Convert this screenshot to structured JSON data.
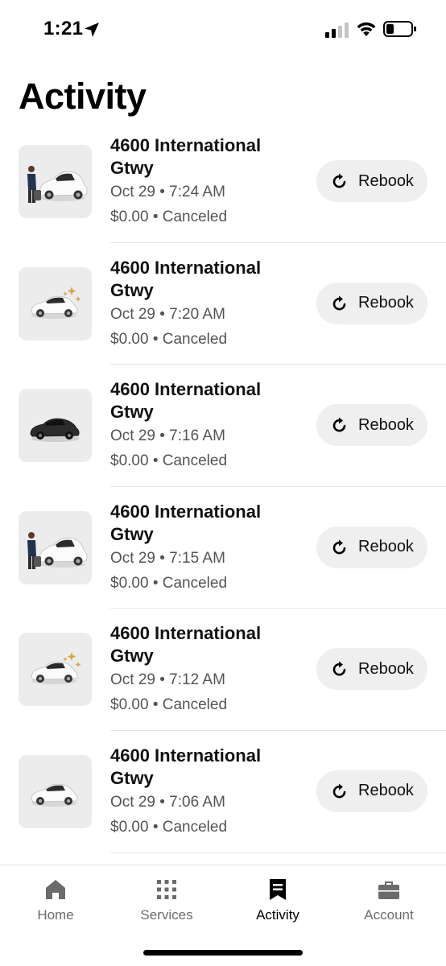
{
  "status_bar": {
    "time": "1:21",
    "icons": [
      "location-arrow-icon",
      "cellular-signal-icon",
      "wifi-icon",
      "battery-icon"
    ]
  },
  "page": {
    "title": "Activity"
  },
  "trips": [
    {
      "address": "4600 International Gtwy",
      "date": "Oct 29 • 7:24 AM",
      "price_status": "$0.00 • Canceled",
      "rebook_label": "Rebook",
      "thumbnail": "car-with-passenger-icon"
    },
    {
      "address": "4600 International Gtwy",
      "date": "Oct 29 • 7:20 AM",
      "price_status": "$0.00 • Canceled",
      "rebook_label": "Rebook",
      "thumbnail": "car-with-sparkles-icon"
    },
    {
      "address": "4600 International Gtwy",
      "date": "Oct 29 • 7:16 AM",
      "price_status": "$0.00 • Canceled",
      "rebook_label": "Rebook",
      "thumbnail": "black-car-icon"
    },
    {
      "address": "4600 International Gtwy",
      "date": "Oct 29 • 7:15 AM",
      "price_status": "$0.00 • Canceled",
      "rebook_label": "Rebook",
      "thumbnail": "car-with-passenger-icon"
    },
    {
      "address": "4600 International Gtwy",
      "date": "Oct 29 • 7:12 AM",
      "price_status": "$0.00 • Canceled",
      "rebook_label": "Rebook",
      "thumbnail": "car-with-sparkles-icon"
    },
    {
      "address": "4600 International Gtwy",
      "date": "Oct 29 • 7:06 AM",
      "price_status": "$0.00 • Canceled",
      "rebook_label": "Rebook",
      "thumbnail": "white-car-icon"
    }
  ],
  "tab_bar": {
    "tabs": [
      {
        "label": "Home",
        "icon": "home-icon",
        "active": false
      },
      {
        "label": "Services",
        "icon": "grid-icon",
        "active": false
      },
      {
        "label": "Activity",
        "icon": "receipt-icon",
        "active": true
      },
      {
        "label": "Account",
        "icon": "briefcase-icon",
        "active": false
      }
    ]
  },
  "colors": {
    "text_primary": "#111111",
    "text_secondary": "#545454",
    "button_bg": "#efefef",
    "thumb_bg": "#ececec",
    "tab_inactive": "#6b6b6b",
    "sparkle": "#d9a548"
  }
}
